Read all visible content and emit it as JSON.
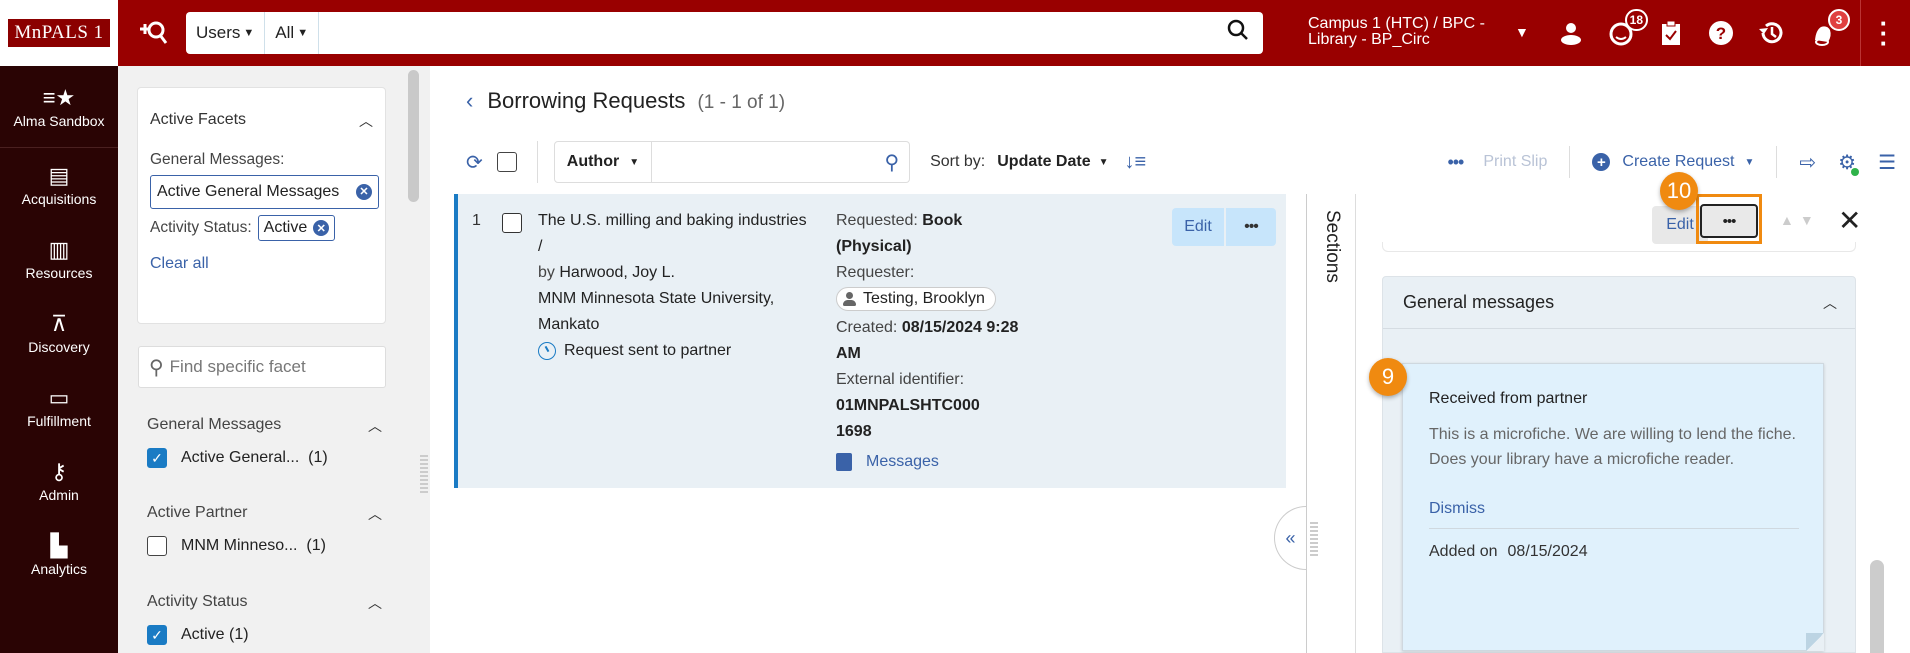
{
  "topbar": {
    "logo": "MnPALS 1",
    "search_scope": "Users",
    "search_field": "All",
    "search_value": "",
    "campus": "Campus 1 (HTC) / BPC - Library - BP_Circ",
    "tasks_badge": "18",
    "notifications_badge": "3"
  },
  "leftnav": {
    "items": [
      {
        "label": "Alma Sandbox",
        "icon": "list-star-icon"
      },
      {
        "label": "Acquisitions",
        "icon": "abacus-icon"
      },
      {
        "label": "Resources",
        "icon": "books-icon"
      },
      {
        "label": "Discovery",
        "icon": "telescope-icon"
      },
      {
        "label": "Fulfillment",
        "icon": "box-icon"
      },
      {
        "label": "Admin",
        "icon": "key-icon"
      },
      {
        "label": "Analytics",
        "icon": "bar-chart-icon"
      }
    ]
  },
  "facets": {
    "active_title": "Active Facets",
    "general_messages_label": "General Messages:",
    "general_messages_chip": "Active General Messages",
    "activity_status_label": "Activity Status:",
    "activity_status_chip": "Active",
    "clear_all": "Clear all",
    "search_placeholder": "Find specific facet",
    "groups": [
      {
        "title": "General Messages",
        "item": "Active General...",
        "count": "(1)",
        "checked": true
      },
      {
        "title": "Active Partner",
        "item": "MNM Minneso...",
        "count": "(1)",
        "checked": false
      },
      {
        "title": "Activity Status",
        "item": "Active",
        "count": "(1)",
        "checked": true
      }
    ]
  },
  "main": {
    "title": "Borrowing Requests",
    "count": "(1 - 1 of 1)",
    "filter_field": "Author",
    "filter_value": "",
    "sort_label": "Sort by:",
    "sort_value": "Update Date",
    "print_slip": "Print Slip",
    "create_request": "Create Request"
  },
  "results": [
    {
      "index": "1",
      "title": "The U.S. milling and baking industries /",
      "by_prefix": "by",
      "author": "Harwood, Joy L.",
      "partner": "MNM Minnesota State University, Mankato",
      "status": "Request sent to partner",
      "requested_label": "Requested:",
      "requested_value": "Book (Physical)",
      "requester_label": "Requester:",
      "requester": "Testing, Brooklyn",
      "created_label": "Created:",
      "created_value": "08/15/2024 9:28 AM",
      "external_id_label": "External identifier:",
      "external_id": "01MNPALSHTC0001698",
      "messages_link": "Messages",
      "edit": "Edit",
      "more": "•••"
    }
  ],
  "detail": {
    "sections_label": "Sections",
    "edit": "Edit",
    "more": "•••",
    "callout_more": "10",
    "callout_message": "9",
    "general_messages_title": "General messages",
    "message": {
      "title": "Received from partner",
      "body": "This is a microfiche. We are  willing to lend the fiche. Does your library have a microfiche reader.",
      "dismiss": "Dismiss",
      "added_label": "Added on",
      "added_value": "08/15/2024"
    }
  }
}
